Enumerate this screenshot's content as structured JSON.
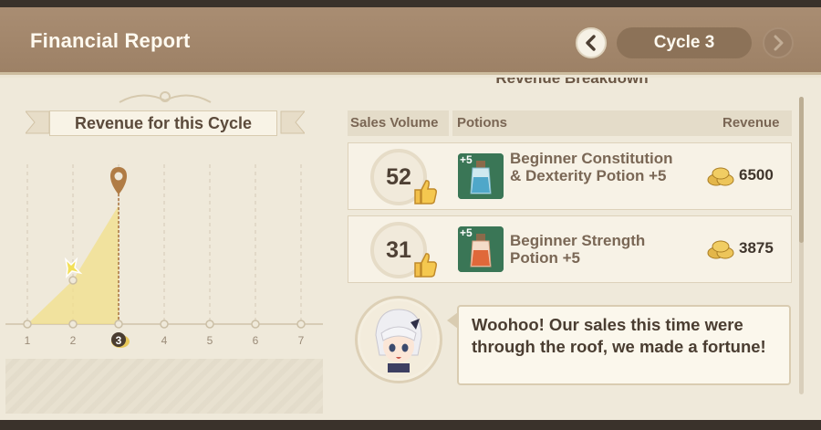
{
  "header": {
    "title": "Financial Report",
    "cycle_label": "Cycle 3"
  },
  "chart": {
    "title": "Revenue for this Cycle",
    "x_ticks": [
      "1",
      "2",
      "3",
      "4",
      "5",
      "6",
      "7"
    ],
    "current_cycle": 3
  },
  "chart_data": {
    "type": "area",
    "title": "Revenue for this Cycle",
    "x": [
      1,
      2,
      3
    ],
    "categories": [
      "1",
      "2",
      "3",
      "4",
      "5",
      "6",
      "7"
    ],
    "xlabel": "",
    "ylabel": "",
    "note_current": 3
  },
  "breakdown": {
    "title": "Revenue Breakdown",
    "columns": {
      "sales_volume": "Sales Volume",
      "potions": "Potions",
      "revenue": "Revenue"
    },
    "rows": [
      {
        "volume": "52",
        "potion_level": "+5",
        "potion_name": "Beginner Constitution & Dexterity Potion +5",
        "revenue": "6500",
        "potion_color": "#4fa7c9"
      },
      {
        "volume": "31",
        "potion_level": "+5",
        "potion_name": "Beginner Strength Potion +5",
        "revenue": "3875",
        "potion_color": "#e0683a"
      }
    ]
  },
  "dialogue": {
    "text": "Woohoo! Our sales this time were through the roof, we made a fortune!"
  },
  "colors": {
    "header": "#a48a6e",
    "accent_gold": "#e8cf63",
    "marker": "#b07c45"
  }
}
